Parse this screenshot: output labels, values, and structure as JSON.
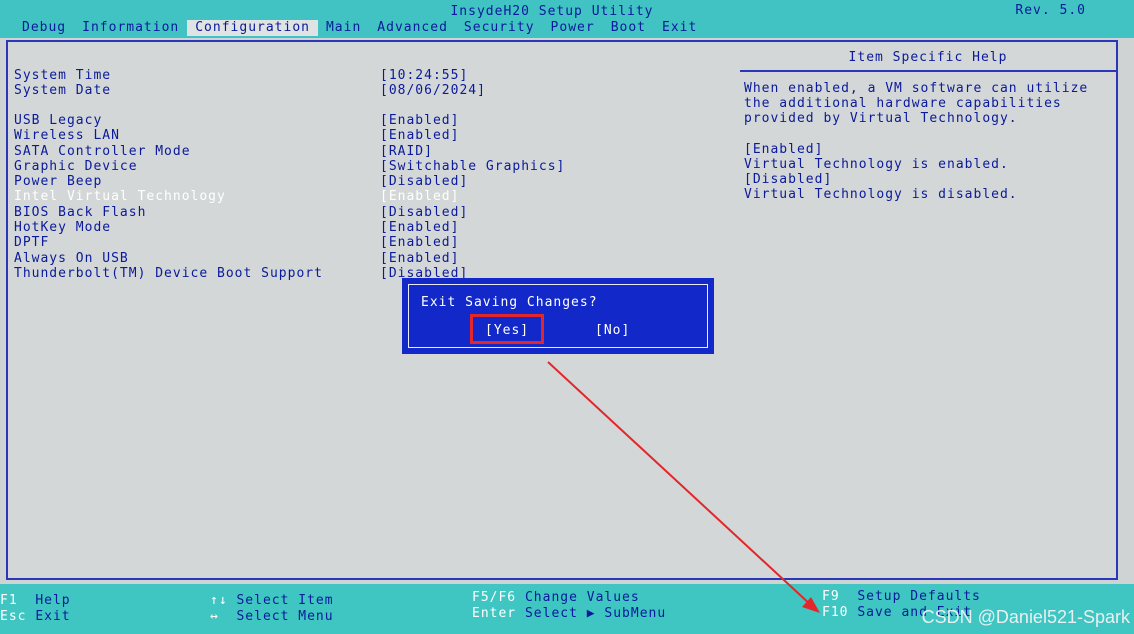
{
  "app_title": "InsydeH20 Setup Utility",
  "revision": "Rev. 5.0",
  "menu": [
    "Debug",
    "Information",
    "Configuration",
    "Main",
    "Advanced",
    "Security",
    "Power",
    "Boot",
    "Exit"
  ],
  "active_menu": "Configuration",
  "settings": [
    {
      "label": "System Time",
      "value": "[10:24:55]"
    },
    {
      "label": "System Date",
      "value": "[08/06/2024]"
    },
    {
      "label": "USB Legacy",
      "value": "[Enabled]"
    },
    {
      "label": "Wireless LAN",
      "value": "[Enabled]"
    },
    {
      "label": "SATA Controller Mode",
      "value": "[RAID]"
    },
    {
      "label": "Graphic Device",
      "value": "[Switchable Graphics]"
    },
    {
      "label": "Power Beep",
      "value": "[Disabled]"
    },
    {
      "label": "Intel Virtual Technology",
      "value": "[Enabled]"
    },
    {
      "label": "BIOS Back Flash",
      "value": "[Disabled]"
    },
    {
      "label": "HotKey Mode",
      "value": "[Enabled]"
    },
    {
      "label": "DPTF",
      "value": "[Enabled]"
    },
    {
      "label": "Always On USB",
      "value": "[Enabled]"
    },
    {
      "label": "Thunderbolt(TM) Device Boot Support",
      "value": "[Disabled]"
    }
  ],
  "help": {
    "title": "Item Specific Help",
    "lines": [
      "When enabled, a VM software can utilize",
      "the additional hardware capabilities",
      "provided by Virtual Technology.",
      "",
      "[Enabled]",
      "Virtual Technology is enabled.",
      "[Disabled]",
      "Virtual Technology is disabled."
    ]
  },
  "dialog": {
    "title": "Exit Saving Changes?",
    "yes": "[Yes]",
    "no": "[No]"
  },
  "footer": {
    "f1_key": "F1",
    "f1_text": "Help",
    "esc_key": "Esc",
    "esc_text": "Exit",
    "updown_key": "↑↓",
    "updown_text": "Select Item",
    "leftright_key": "↔",
    "leftright_text": "Select Menu",
    "f5f6_key": "F5/F6",
    "f5f6_text": "Change Values",
    "enter_key": "Enter",
    "enter_text": "Select ▶ SubMenu",
    "f9_key": "F9",
    "f9_text": "Setup Defaults",
    "f10_key": "F10",
    "f10_text": "Save and Exit"
  },
  "watermark": "CSDN @Daniel521-Spark",
  "colors": {
    "bios_blue": "#0a1a9a",
    "cyan_bar": "#41c3c3",
    "dialog_blue": "#1228c8",
    "annotation_red": "#e3262a"
  }
}
